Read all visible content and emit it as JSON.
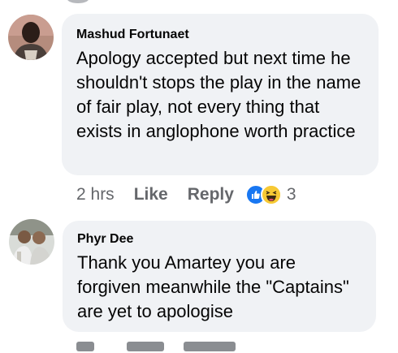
{
  "comments": [
    {
      "author": "Mashud Fortunaet",
      "text": "Apology accepted but next time he shouldn't stops the play in the name of fair play, not every thing that exists in anglophone worth practice",
      "time": "2 hrs",
      "like_label": "Like",
      "reply_label": "Reply",
      "reactions": [
        "like-reaction-icon",
        "haha-reaction-icon"
      ],
      "reaction_count": "3",
      "colors": {
        "like_reaction": "#1877f2",
        "haha_reaction": "#f7c934"
      }
    },
    {
      "author": "Phyr Dee",
      "text": "Thank you Amartey you are forgiven meanwhile the \"Captains\" are yet to apologise"
    }
  ],
  "colors": {
    "bubble_background": "#f0f2f5",
    "text": "#050505",
    "meta_text": "#65676b"
  }
}
